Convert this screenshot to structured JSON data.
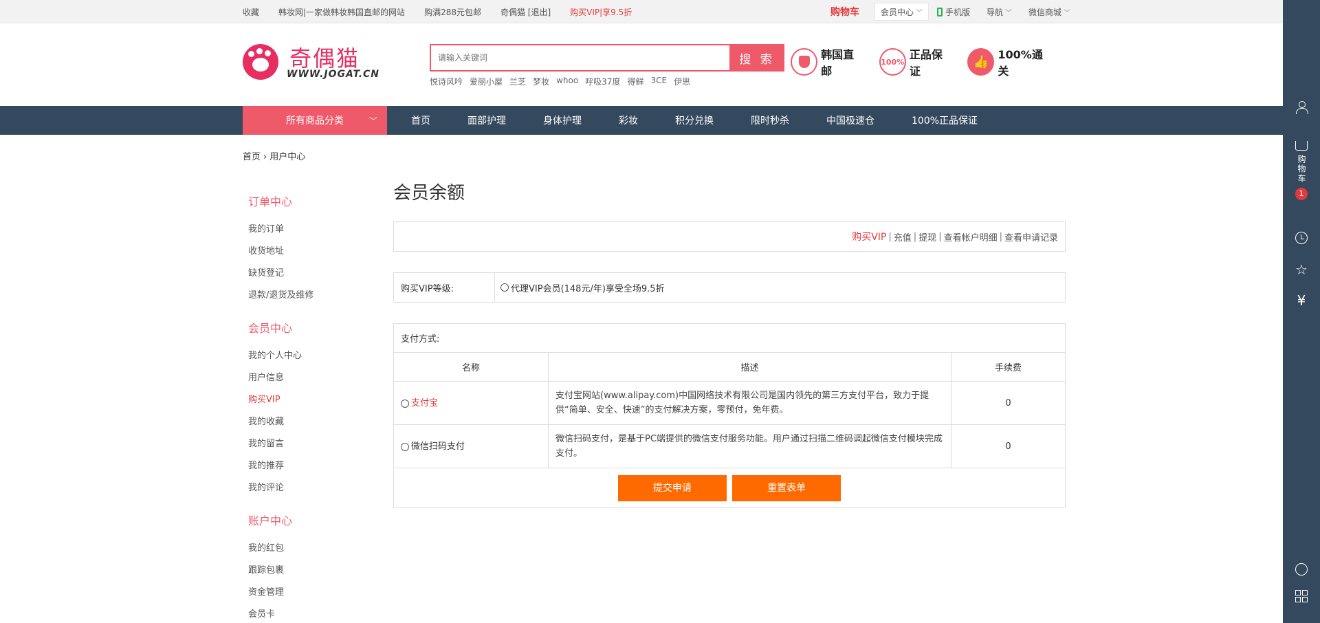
{
  "topbar": {
    "favorite": "收藏",
    "slogan": "韩妆网|一家做韩妆韩国直邮的网站",
    "free_ship": "购满288元包邮",
    "user": "奇偶猫 [退出]",
    "vip_promo": "购买VIP|享9.5折",
    "cart": "购物车",
    "member_center": "会员中心",
    "mobile": "手机版",
    "nav": "导航",
    "wechat_mall": "微信商城"
  },
  "logo": {
    "cn": "奇偶猫",
    "en": "WWW.JOGAT.CN"
  },
  "search": {
    "placeholder": "请输入关键词",
    "button": "搜 索",
    "hotwords": [
      "悦诗风吟",
      "爱丽小屋",
      "兰芝",
      "梦妆",
      "whoo",
      "呼吸37度",
      "得鲜",
      "3CE",
      "伊思"
    ]
  },
  "guarantees": [
    {
      "label": "韩国直邮",
      "icon": "shield-icon"
    },
    {
      "label": "正品保证",
      "badge": "100%"
    },
    {
      "label": "100%通关",
      "icon": "thumbs-up-icon"
    }
  ],
  "nav": {
    "category": "所有商品分类",
    "links": [
      "首页",
      "面部护理",
      "身体护理",
      "彩妆",
      "积分兑换",
      "限时秒杀",
      "中国极速仓",
      "100%正品保证"
    ]
  },
  "breadcrumb": {
    "home": "首页",
    "current": "用户中心"
  },
  "sidebar": {
    "groups": [
      {
        "title": "订单中心",
        "items": [
          "我的订单",
          "收货地址",
          "缺货登记",
          "退款/退货及维修"
        ]
      },
      {
        "title": "会员中心",
        "items": [
          "我的个人中心",
          "用户信息",
          "购买VIP",
          "我的收藏",
          "我的留言",
          "我的推荐",
          "我的评论"
        ]
      },
      {
        "title": "账户中心",
        "items": [
          "我的红包",
          "跟踪包裹",
          "资金管理",
          "会员卡"
        ]
      }
    ],
    "active": "购买VIP"
  },
  "main": {
    "title": "会员余额",
    "account_links": [
      "购买VIP",
      "充值",
      "提现",
      "查看帐户明细",
      "查看申请记录"
    ],
    "vip_label": "购买VIP等级:",
    "vip_option": "代理VIP会员(148元/年)享受全场9.5折",
    "payment_title": "支付方式:",
    "columns": [
      "名称",
      "描述",
      "手续费"
    ],
    "methods": [
      {
        "name": "支付宝",
        "desc": "支付宝网站(www.alipay.com)中国网络技术有限公司是国内领先的第三方支付平台，致力于提供“简单、安全、快速”的支付解决方案，零预付，免年费。",
        "fee": "0"
      },
      {
        "name": "微信扫码支付",
        "desc": "微信扫码支付，是基于PC端提供的微信支付服务功能。用户通过扫描二维码调起微信支付模块完成支付。",
        "fee": "0"
      }
    ],
    "submit": "提交申请",
    "reset": "重置表单"
  },
  "toolbar": {
    "cart_text": "购物车",
    "cart_count": "1"
  },
  "colors": {
    "accent": "#ef5a6a",
    "nav_bg": "#34495e",
    "button": "#ff6a00",
    "link_red": "#e4393c"
  }
}
